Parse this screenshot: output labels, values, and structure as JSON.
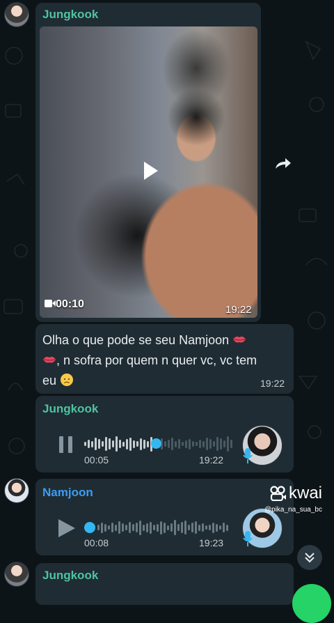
{
  "messages": [
    {
      "sender": "Jungkook",
      "video": {
        "duration": "00:10",
        "time": "19:22"
      }
    },
    {
      "text_line1": "Olha o que pode se seu Namjoon",
      "text_line2": ", n sofra por quem n quer vc, vc tem",
      "text_line3": "eu",
      "time": "19:22"
    },
    {
      "sender": "Jungkook",
      "audio": {
        "position": "00:05",
        "time": "19:22",
        "state": "playing",
        "progress": 0.45
      }
    },
    {
      "sender": "Namjoon",
      "audio": {
        "position": "00:08",
        "time": "19:23",
        "state": "paused",
        "progress": 0.0
      }
    },
    {
      "sender": "Jungkook"
    }
  ],
  "watermark": {
    "brand": "kwai",
    "username": "@pika_na_sua_bc"
  },
  "colors": {
    "background": "#0d1418",
    "bubble": "#1f2c34",
    "sender_green": "#4fc3a1",
    "sender_blue": "#3d9df3",
    "audio_progress": "#34b7f1",
    "fab": "#25d366"
  },
  "icons": [
    "play-icon",
    "video-camera-icon",
    "pause-icon",
    "mic-icon",
    "forward-icon",
    "kwai-logo-icon",
    "chevron-double-down-icon",
    "kiss-lips-emoji",
    "sad-face-emoji"
  ]
}
